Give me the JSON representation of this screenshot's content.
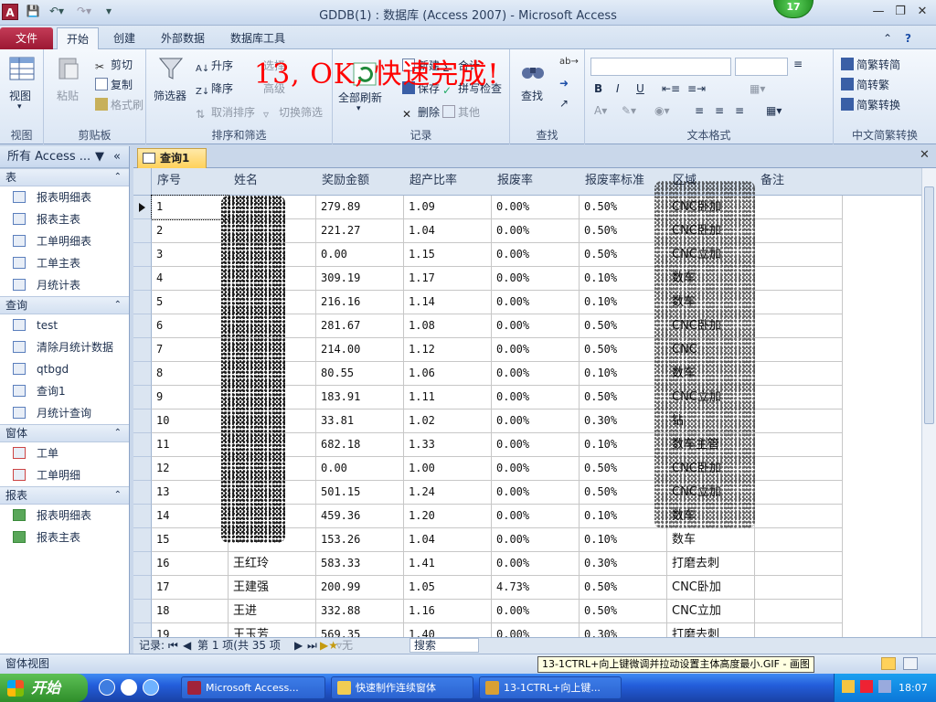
{
  "window": {
    "title": "GDDB(1) : 数据库 (Access 2007) - Microsoft Access",
    "badge": "17",
    "app_icon": "A"
  },
  "ribbon_tabs": [
    {
      "label": "文件"
    },
    {
      "label": "开始"
    },
    {
      "label": "创建"
    },
    {
      "label": "外部数据"
    },
    {
      "label": "数据库工具"
    }
  ],
  "ribbon": {
    "view": {
      "label": "视图",
      "group": "视图"
    },
    "clipboard": {
      "paste": "粘贴",
      "cut": "剪切",
      "copy": "复制",
      "format_painter": "格式刷",
      "group": "剪贴板"
    },
    "sort_filter": {
      "filter": "筛选器",
      "asc": "升序",
      "desc": "降序",
      "clear_sort": "取消排序",
      "select": "选择",
      "advanced": "高级",
      "toggle": "切换筛选",
      "group": "排序和筛选"
    },
    "records": {
      "refresh": "全部刷新",
      "new": "新建",
      "save": "保存",
      "delete": "删除",
      "totals": "合计",
      "spelling": "拼写检查",
      "more": "其他",
      "group": "记录"
    },
    "find": {
      "find": "查找",
      "group": "查找"
    },
    "text_format": {
      "group": "文本格式"
    },
    "chinese": {
      "to_trad": "简繁转简",
      "to_simp": "简转繁",
      "convert": "简繁转换",
      "group": "中文简繁转换"
    }
  },
  "overlay_text": "13, OK, 快速完成!",
  "nav": {
    "header": "所有 Access ...",
    "sections": [
      {
        "title": "表",
        "items": [
          "报表明细表",
          "报表主表",
          "工单明细表",
          "工单主表",
          "月统计表"
        ]
      },
      {
        "title": "查询",
        "items": [
          "test",
          "清除月统计数据",
          "qtbgd",
          "查询1",
          "月统计查询"
        ]
      },
      {
        "title": "窗体",
        "items": [
          "工单",
          "工单明细"
        ]
      },
      {
        "title": "报表",
        "items": [
          "报表明细表",
          "报表主表"
        ]
      }
    ]
  },
  "query_tab": {
    "label": "查询1"
  },
  "table": {
    "columns": [
      "序号",
      "姓名",
      "奖励金额",
      "超产比率",
      "报废率",
      "报废率标准",
      "区域",
      "备注"
    ],
    "rows": [
      [
        "1",
        "",
        "279.89",
        "1.09",
        "0.00%",
        "0.50%",
        "CNC卧加",
        ""
      ],
      [
        "2",
        "",
        "221.27",
        "1.04",
        "0.00%",
        "0.50%",
        "CNC卧加",
        ""
      ],
      [
        "3",
        "",
        "0.00",
        "1.15",
        "0.00%",
        "0.50%",
        "CNC立加",
        ""
      ],
      [
        "4",
        "",
        "309.19",
        "1.17",
        "0.00%",
        "0.10%",
        "数车",
        ""
      ],
      [
        "5",
        "",
        "216.16",
        "1.14",
        "0.00%",
        "0.10%",
        "数车",
        ""
      ],
      [
        "6",
        "",
        "281.67",
        "1.08",
        "0.00%",
        "0.50%",
        "CNC卧加",
        ""
      ],
      [
        "7",
        "",
        "214.00",
        "1.12",
        "0.00%",
        "0.50%",
        "CNC",
        ""
      ],
      [
        "8",
        "",
        "80.55",
        "1.06",
        "0.00%",
        "0.10%",
        "数车",
        ""
      ],
      [
        "9",
        "",
        "183.91",
        "1.11",
        "0.00%",
        "0.50%",
        "CNC立加",
        ""
      ],
      [
        "10",
        "",
        "33.81",
        "1.02",
        "0.00%",
        "0.30%",
        "钻",
        ""
      ],
      [
        "11",
        "",
        "682.18",
        "1.33",
        "0.00%",
        "0.10%",
        "数车主管",
        ""
      ],
      [
        "12",
        "",
        "0.00",
        "1.00",
        "0.00%",
        "0.50%",
        "CNC卧加",
        ""
      ],
      [
        "13",
        "",
        "501.15",
        "1.24",
        "0.00%",
        "0.50%",
        "CNC立加",
        ""
      ],
      [
        "14",
        "",
        "459.36",
        "1.20",
        "0.00%",
        "0.10%",
        "数车",
        ""
      ],
      [
        "15",
        "",
        "153.26",
        "1.04",
        "0.00%",
        "0.10%",
        "数车",
        ""
      ],
      [
        "16",
        "王红玲",
        "583.33",
        "1.41",
        "0.00%",
        "0.30%",
        "打磨去刺",
        ""
      ],
      [
        "17",
        "王建强",
        "200.99",
        "1.05",
        "4.73%",
        "0.50%",
        "CNC卧加",
        ""
      ],
      [
        "18",
        "王进",
        "332.88",
        "1.16",
        "0.00%",
        "0.50%",
        "CNC立加",
        ""
      ],
      [
        "19",
        "王玉芳",
        "569.35",
        "1.40",
        "0.00%",
        "0.30%",
        "打磨去刺",
        ""
      ]
    ]
  },
  "record_nav": {
    "prefix": "记录:",
    "position": "第 1 项(共 35 项",
    "filter": "无筛选器",
    "search": "搜索"
  },
  "status": {
    "left": "窗体视图",
    "tooltip": "13-1CTRL+向上键微调并拉动设置主体高度最小.GIF - 画图"
  },
  "taskbar": {
    "start": "开始",
    "tasks": [
      "Microsoft Access...",
      "快速制作连续窗体",
      "13-1CTRL+向上键..."
    ],
    "clock": "18:07"
  }
}
